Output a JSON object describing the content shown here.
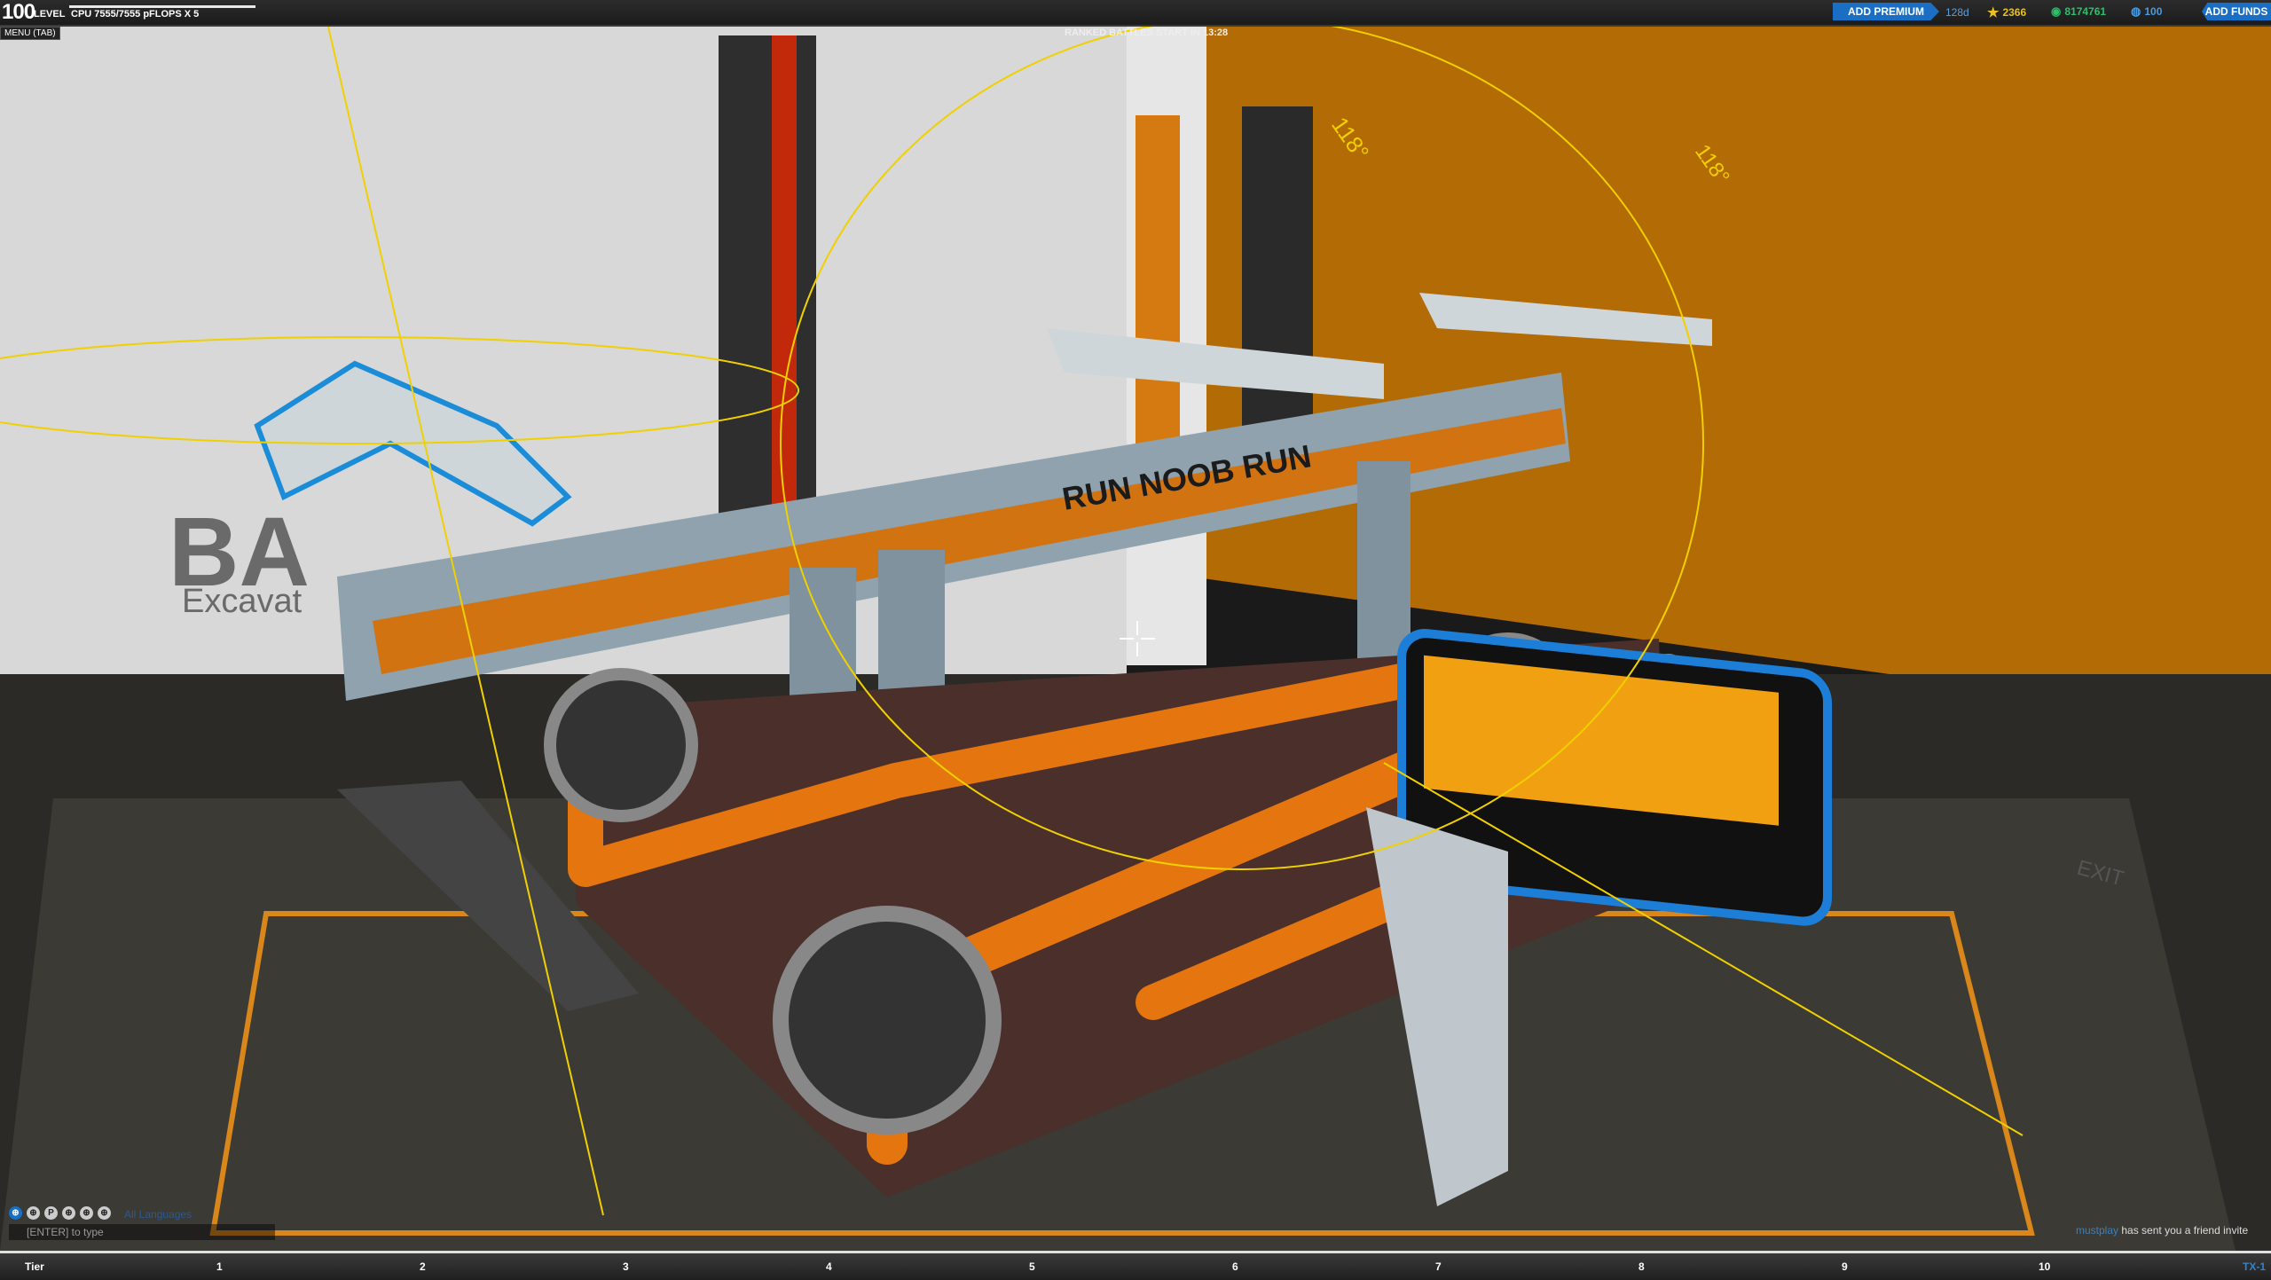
{
  "hud": {
    "level_number": "100",
    "level_label": "LEVEL",
    "cpu_text": "CPU 7555/7555 pFLOPS X 5",
    "menu_tab": "MENU (TAB)",
    "ranked_text": "RANKED BATTLES START IN 13:28",
    "premium_button": "ADD PREMIUM",
    "premium_days": "128d",
    "stars": "2366",
    "robits": "8174761",
    "cosmetic": "100",
    "add_funds_button": "ADD FUNDS"
  },
  "scene": {
    "robot_label": "RUN NOOB RUN",
    "wall_text_big": "BA",
    "wall_text_small": "Excavat",
    "angle_label_1": "118°",
    "angle_label_2": "118°",
    "exit_sign": "EXIT"
  },
  "chat": {
    "channel_icons": [
      "⊕",
      "⊕",
      "P",
      "⊕",
      "⊕",
      "⊕"
    ],
    "language": "All Languages",
    "input_hint": "[ENTER] to type",
    "invite_user": "mustplay",
    "invite_text": "has sent you a friend invite"
  },
  "tierbar": {
    "label": "Tier",
    "ticks": [
      "1",
      "2",
      "3",
      "4",
      "5",
      "6",
      "7",
      "8",
      "9",
      "10"
    ],
    "current": "TX-1"
  },
  "colors": {
    "orange": "#c87410",
    "accent_blue": "#1a6fc4",
    "guide_yellow": "#f0d000"
  }
}
